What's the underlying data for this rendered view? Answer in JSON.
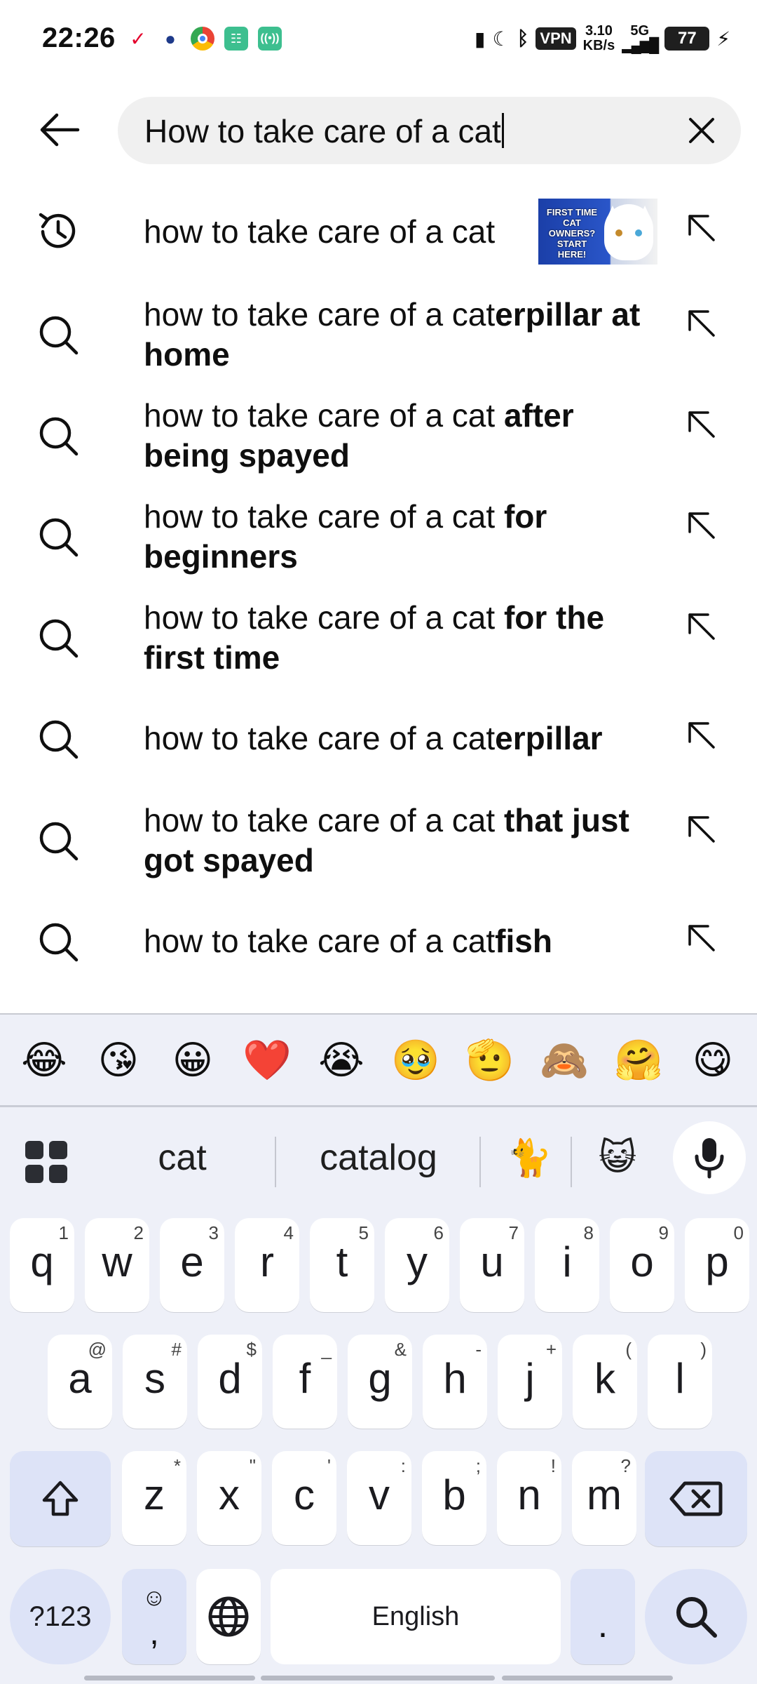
{
  "status_bar": {
    "time": "22:26",
    "vpn": "VPN",
    "net_speed_value": "3.10",
    "net_speed_unit": "KB/s",
    "network": "5G",
    "battery": "77"
  },
  "search": {
    "query": "How to take care of a cat"
  },
  "suggestions": [
    {
      "type": "history",
      "prefix": "how to take care of a cat",
      "suffix": "",
      "has_thumbnail": true,
      "thumbnail_text": "FIRST TIME CAT OWNERS? START HERE!"
    },
    {
      "type": "search",
      "prefix": "how to take care of a cat",
      "suffix": "erpillar at home"
    },
    {
      "type": "search",
      "prefix": "how to take care of a cat",
      "suffix": " after being spayed"
    },
    {
      "type": "search",
      "prefix": "how to take care of a cat",
      "suffix": " for beginners"
    },
    {
      "type": "search",
      "prefix": "how to take care of a cat",
      "suffix": " for the first time"
    },
    {
      "type": "search",
      "prefix": "how to take care of a cat",
      "suffix": "erpillar"
    },
    {
      "type": "search",
      "prefix": "how to take care of a cat",
      "suffix": " that just got spayed"
    },
    {
      "type": "search",
      "prefix": "how to take care of a cat",
      "suffix": "fish"
    }
  ],
  "keyboard": {
    "emojis": [
      "😂",
      "😘",
      "😀",
      "❤️",
      "😭",
      "🥹",
      "🫡",
      "🙈",
      "🤗",
      "😋"
    ],
    "word_suggestions": [
      "cat",
      "catalog",
      "🐈",
      "😺"
    ],
    "row1": [
      {
        "k": "q",
        "s": "1"
      },
      {
        "k": "w",
        "s": "2"
      },
      {
        "k": "e",
        "s": "3"
      },
      {
        "k": "r",
        "s": "4"
      },
      {
        "k": "t",
        "s": "5"
      },
      {
        "k": "y",
        "s": "6"
      },
      {
        "k": "u",
        "s": "7"
      },
      {
        "k": "i",
        "s": "8"
      },
      {
        "k": "o",
        "s": "9"
      },
      {
        "k": "p",
        "s": "0"
      }
    ],
    "row2": [
      {
        "k": "a",
        "s": "@"
      },
      {
        "k": "s",
        "s": "#"
      },
      {
        "k": "d",
        "s": "$"
      },
      {
        "k": "f",
        "s": "_"
      },
      {
        "k": "g",
        "s": "&"
      },
      {
        "k": "h",
        "s": "-"
      },
      {
        "k": "j",
        "s": "+"
      },
      {
        "k": "k",
        "s": "("
      },
      {
        "k": "l",
        "s": ")"
      }
    ],
    "row3": [
      {
        "k": "z",
        "s": "*"
      },
      {
        "k": "x",
        "s": "\""
      },
      {
        "k": "c",
        "s": "'"
      },
      {
        "k": "v",
        "s": ":"
      },
      {
        "k": "b",
        "s": ";"
      },
      {
        "k": "n",
        "s": "!"
      },
      {
        "k": "m",
        "s": "?"
      }
    ],
    "symbols_label": "?123",
    "comma_key": ",",
    "space_label": "English",
    "period_key": "."
  }
}
